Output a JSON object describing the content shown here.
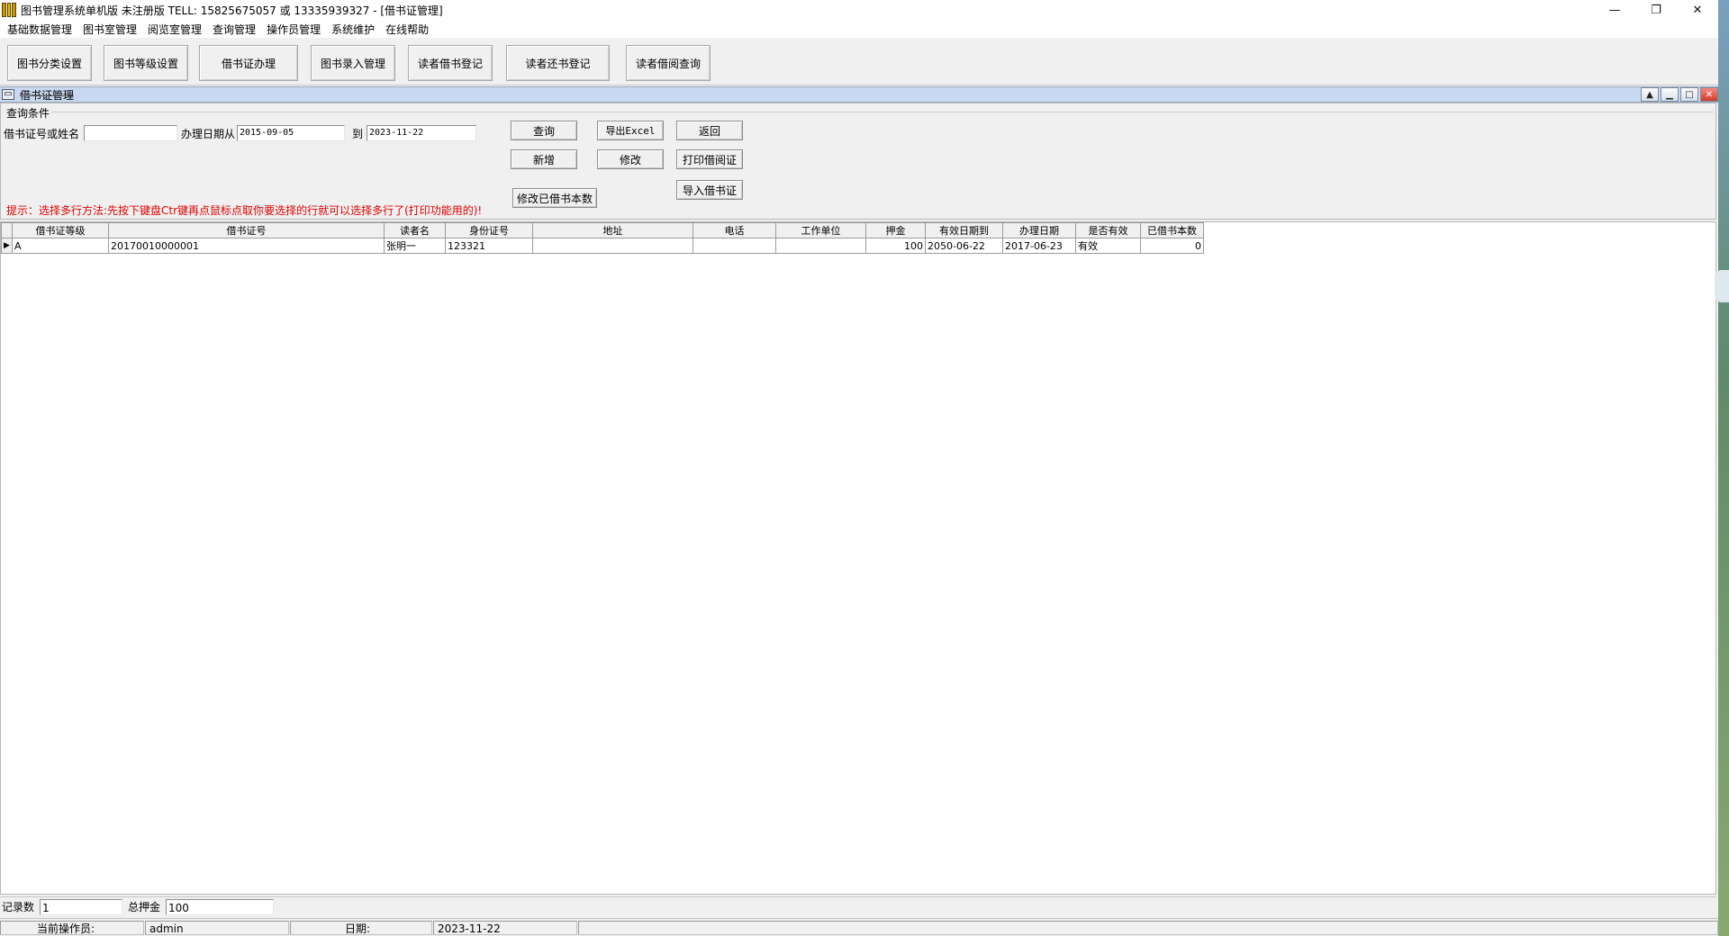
{
  "window": {
    "title": "图书管理系统单机版 未注册版 TELL: 15825675057 或 13335939327 - [借书证管理]",
    "controls": {
      "minimize": "—",
      "restore": "❐",
      "close": "✕"
    }
  },
  "menu": [
    "基础数据管理",
    "图书室管理",
    "阅览室管理",
    "查询管理",
    "操作员管理",
    "系统维护",
    "在线帮助"
  ],
  "toolbar": [
    "图书分类设置",
    "图书等级设置",
    "借书证办理",
    "图书录入管理",
    "读者借书登记",
    "读者还书登记",
    "读者借阅查询"
  ],
  "child": {
    "title": "借书证管理",
    "icon": "▭",
    "controls": [
      "▲",
      "▁",
      "□",
      "✕"
    ]
  },
  "query": {
    "group_label": "查询条件",
    "card_label": "借书证号或姓名",
    "card_value": "",
    "date_label": "办理日期从",
    "date_from": "2015-09-05",
    "to_label": "到",
    "date_to": "2023-11-22",
    "buttons": {
      "search": "查询",
      "export": "导出Excel",
      "back": "返回",
      "add": "新增",
      "edit": "修改",
      "print": "打印借阅证",
      "edit_count": "修改已借书本数",
      "import": "导入借书证"
    },
    "hint": "提示：选择多行方法:先按下键盘Ctr键再点鼠标点取你要选择的行就可以选择多行了(打印功能用的)!"
  },
  "table": {
    "columns": [
      "借书证等级",
      "借书证号",
      "读者名",
      "身份证号",
      "地址",
      "电话",
      "工作单位",
      "押金",
      "有效日期到",
      "办理日期",
      "是否有效",
      "已借书本数"
    ],
    "rows": [
      {
        "selector": "▶",
        "cells": [
          "A",
          "20170010000001",
          "张明一",
          "123321",
          "",
          "",
          "",
          "100",
          "2050-06-22",
          "2017-06-23",
          "有效",
          "0"
        ]
      }
    ]
  },
  "summary": {
    "count_label": "记录数",
    "count_value": "1",
    "deposit_label": "总押金",
    "deposit_value": "100"
  },
  "status": {
    "operator_label": "当前操作员:",
    "operator_value": "admin",
    "date_label": "日期:",
    "date_value": "2023-11-22"
  }
}
